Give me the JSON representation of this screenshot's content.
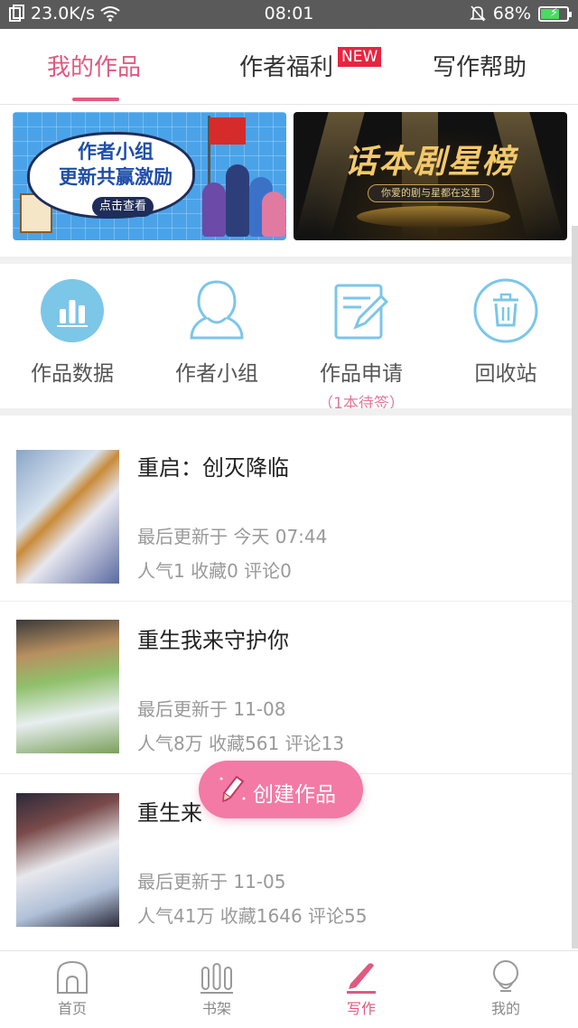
{
  "status_bar": {
    "net_speed": "23.0K/s",
    "time": "08:01",
    "battery_percent": "68%",
    "battery_level": 0.68
  },
  "tabs": [
    {
      "label": "我的作品",
      "active": true
    },
    {
      "label": "作者福利",
      "badge": "NEW"
    },
    {
      "label": "写作帮助"
    }
  ],
  "banners": {
    "left": {
      "title_line1": "作者小组",
      "title_line2": "更新共赢激励",
      "button": "点击查看"
    },
    "right": {
      "title": "话本剧星榜",
      "subtitle": "你爱的剧与星都在这里"
    }
  },
  "features": [
    {
      "label": "作品数据",
      "icon": "bar-chart-icon"
    },
    {
      "label": "作者小组",
      "icon": "person-icon"
    },
    {
      "label": "作品申请",
      "sub": "（1本待签）",
      "icon": "edit-document-icon"
    },
    {
      "label": "回收站",
      "icon": "trash-icon"
    }
  ],
  "works": [
    {
      "title": "重启：创灭降临",
      "updated": "最后更新于 今天 07:44",
      "stats": "人气1  收藏0  评论0"
    },
    {
      "title": "重生我来守护你",
      "updated": "最后更新于 11-08",
      "stats": "人气8万  收藏561  评论13"
    },
    {
      "title": "重生来",
      "updated": "最后更新于 11-05",
      "stats": "人气41万  收藏1646  评论55"
    }
  ],
  "fab": {
    "label": "创建作品"
  },
  "bottom_nav": [
    {
      "label": "首页",
      "icon": "home-icon"
    },
    {
      "label": "书架",
      "icon": "bookshelf-icon"
    },
    {
      "label": "写作",
      "icon": "pen-icon",
      "active": true
    },
    {
      "label": "我的",
      "icon": "profile-icon"
    }
  ],
  "colors": {
    "accent": "#e05a80",
    "fab": "#f27aa4",
    "icon_blue": "#7cc6e8"
  }
}
